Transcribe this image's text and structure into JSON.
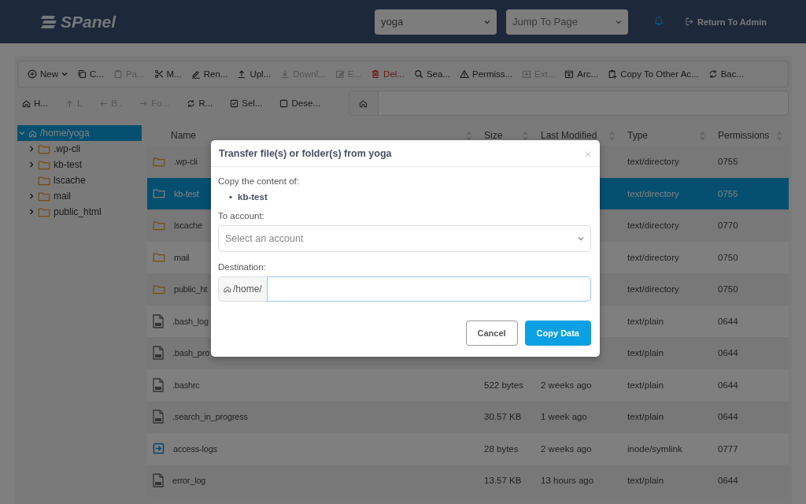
{
  "header": {
    "logo": "SPanel",
    "account_select": {
      "value": "yoga"
    },
    "page_select": {
      "placeholder": "Jump To Page"
    },
    "return_link": "Return To Admin"
  },
  "toolbar": [
    {
      "label": "New",
      "disabled": false,
      "danger": false,
      "dropdown": true
    },
    {
      "label": "C...",
      "disabled": false,
      "danger": false,
      "dropdown": false
    },
    {
      "label": "Pa...",
      "disabled": true,
      "danger": false,
      "dropdown": false
    },
    {
      "label": "M...",
      "disabled": false,
      "danger": false,
      "dropdown": false
    },
    {
      "label": "Ren...",
      "disabled": false,
      "danger": false,
      "dropdown": false
    },
    {
      "label": "Upl...",
      "disabled": false,
      "danger": false,
      "dropdown": false
    },
    {
      "label": "Downl...",
      "disabled": true,
      "danger": false,
      "dropdown": false
    },
    {
      "label": "E...",
      "disabled": true,
      "danger": false,
      "dropdown": false
    },
    {
      "label": "Del...",
      "disabled": false,
      "danger": true,
      "dropdown": false
    },
    {
      "label": "Sea...",
      "disabled": false,
      "danger": false,
      "dropdown": false
    },
    {
      "label": "Permiss...",
      "disabled": false,
      "danger": false,
      "dropdown": false
    },
    {
      "label": "Ext...",
      "disabled": true,
      "danger": false,
      "dropdown": false
    },
    {
      "label": "Arc...",
      "disabled": false,
      "danger": false,
      "dropdown": false
    },
    {
      "label": "Copy To Other Ac...",
      "disabled": false,
      "danger": false,
      "dropdown": false
    },
    {
      "label": "Bac...",
      "disabled": false,
      "danger": false,
      "dropdown": false
    }
  ],
  "nav_toolbar": [
    {
      "label": "H...",
      "disabled": false
    },
    {
      "label": "L",
      "disabled": true
    },
    {
      "label": "B..",
      "disabled": true
    },
    {
      "label": "Fo...",
      "disabled": true
    },
    {
      "label": "R...",
      "disabled": false
    },
    {
      "label": "Sel...",
      "disabled": false
    },
    {
      "label": "Dese...",
      "disabled": false
    }
  ],
  "tree": {
    "label": "/home/yoga",
    "selected": true,
    "expanded": true,
    "children": [
      {
        "label": ".wp-cli",
        "expandable": true
      },
      {
        "label": "kb-test",
        "expandable": true
      },
      {
        "label": "lscache",
        "expandable": false
      },
      {
        "label": "mail",
        "expandable": true
      },
      {
        "label": "public_html",
        "expandable": true
      }
    ]
  },
  "table": {
    "columns": [
      "Name",
      "Size",
      "Last Modified",
      "Type",
      "Permissions"
    ],
    "rows": [
      {
        "kind": "folder",
        "name": ".wp-cli",
        "type": "text/directory",
        "permissions": "0755",
        "selected": false
      },
      {
        "kind": "folder",
        "name": "kb-test",
        "type": "text/directory",
        "permissions": "0755",
        "selected": true
      },
      {
        "kind": "folder",
        "name": "lscache",
        "type": "text/directory",
        "permissions": "0770",
        "selected": false
      },
      {
        "kind": "folder",
        "name": "mail",
        "type": "text/directory",
        "permissions": "0750",
        "selected": false
      },
      {
        "kind": "folder",
        "name": "public_ht",
        "type": "text/directory",
        "permissions": "0750",
        "selected": false
      },
      {
        "kind": "file",
        "name": ".bash_log",
        "type": "text/plain",
        "permissions": "0644",
        "selected": false
      },
      {
        "kind": "file",
        "name": ".bash_pro",
        "type": "text/plain",
        "permissions": "0644",
        "selected": false
      },
      {
        "kind": "file",
        "name": ".bashrc",
        "size": "522 bytes",
        "modified": "2 weeks ago",
        "type": "text/plain",
        "permissions": "0644",
        "selected": false
      },
      {
        "kind": "file",
        "name": ".search_in_progress",
        "size": "30.57 KB",
        "modified": "1 week ago",
        "type": "text/plain",
        "permissions": "0644",
        "selected": false
      },
      {
        "kind": "symlink",
        "name": "access-logs",
        "size": "28 bytes",
        "modified": "2 weeks ago",
        "type": "inode/symlink",
        "permissions": "0777",
        "selected": false
      },
      {
        "kind": "file",
        "name": "error_log",
        "size": "13.57 KB",
        "modified": "13 hours ago",
        "type": "text/plain",
        "permissions": "0644",
        "selected": false
      }
    ]
  },
  "dialog": {
    "title": "Transfer file(s) or folder(s) from yoga",
    "content_label": "Copy the content of:",
    "items": [
      {
        "marker": "•",
        "text": "kb-test"
      }
    ],
    "account_label": "To account:",
    "account_placeholder": "Select an account",
    "destination_label": "Destination:",
    "destination_prefix": "/home/",
    "buttons": [
      "Cancel",
      "Copy Data"
    ]
  }
}
